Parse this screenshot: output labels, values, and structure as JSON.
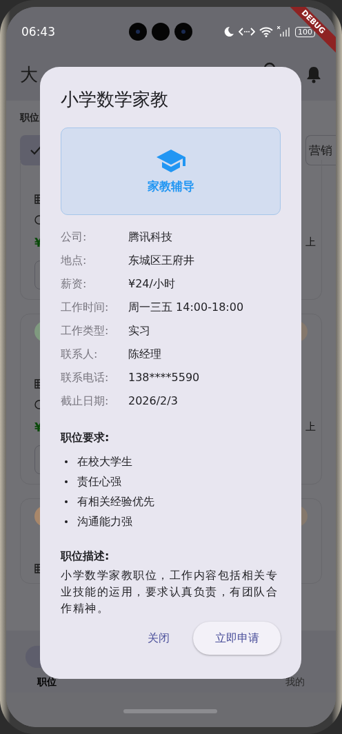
{
  "status_bar": {
    "time": "06:43",
    "battery": "100"
  },
  "debug_banner": "DEBUG",
  "app_bar": {
    "title": "大"
  },
  "filter": {
    "label": "职位",
    "chips": [
      {
        "selected": true
      },
      {
        "label": "营销",
        "selected": false
      }
    ]
  },
  "job_cards": [
    {
      "salary": "¥",
      "note": "上"
    },
    {
      "salary": "¥",
      "note": "上",
      "color": "#7f9a7f"
    },
    {
      "color": "#a8876a"
    }
  ],
  "bottom_nav": [
    {
      "label": "职位",
      "selected": true
    },
    {
      "label": "我的",
      "selected": false
    }
  ],
  "dialog": {
    "title": "小学数学家教",
    "category": "家教辅导",
    "fields": [
      {
        "label": "公司:",
        "value": "腾讯科技"
      },
      {
        "label": "地点:",
        "value": "东城区王府井"
      },
      {
        "label": "薪资:",
        "value": "¥24/小时"
      },
      {
        "label": "工作时间:",
        "value": "周一三五 14:00-18:00"
      },
      {
        "label": "工作类型:",
        "value": "实习"
      },
      {
        "label": "联系人:",
        "value": "陈经理"
      },
      {
        "label": "联系电话:",
        "value": "138****5590"
      },
      {
        "label": "截止日期:",
        "value": "2026/2/3"
      }
    ],
    "requirements_title": "职位要求:",
    "requirements": [
      "在校大学生",
      "责任心强",
      "有相关经验优先",
      "沟通能力强"
    ],
    "description_title": "职位描述:",
    "description": "小学数学家教职位，工作内容包括相关专业技能的运用，要求认真负责，有团队合作精神。",
    "buttons": [
      {
        "label": "关闭",
        "kind": "text"
      },
      {
        "label": "立即申请",
        "kind": "filled"
      }
    ]
  }
}
